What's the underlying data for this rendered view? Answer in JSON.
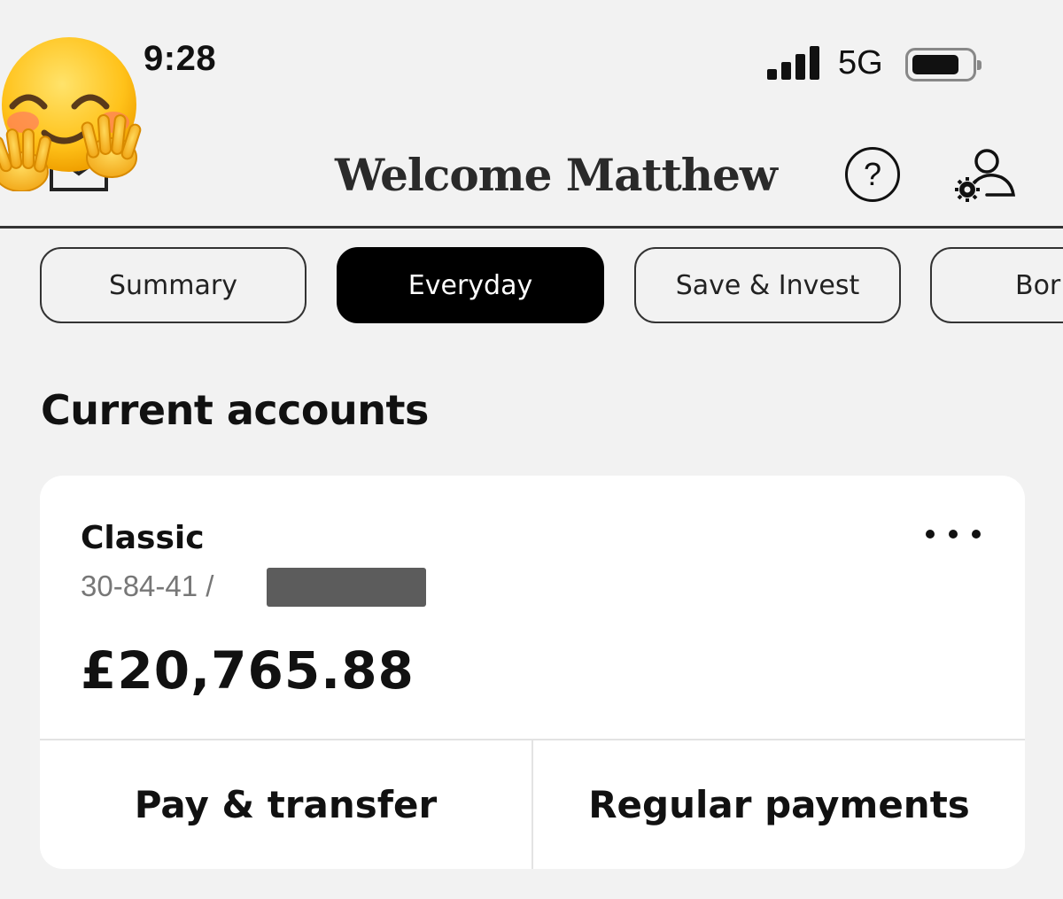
{
  "status_bar": {
    "time": "9:28",
    "network": "5G",
    "icons": [
      "signal-bars-icon",
      "battery-icon"
    ]
  },
  "header": {
    "title": "Welcome Matthew",
    "help_symbol": "?",
    "icons": [
      "mail-icon",
      "help-icon",
      "profile-settings-icon"
    ]
  },
  "sticker": "hugging-face-emoji",
  "tabs": [
    {
      "label": "Summary",
      "active": false
    },
    {
      "label": "Everyday",
      "active": true
    },
    {
      "label": "Save & Invest",
      "active": false
    },
    {
      "label": "Bor",
      "active": false
    }
  ],
  "section": {
    "title": "Current accounts"
  },
  "account": {
    "name": "Classic",
    "sort_code": "30-84-41 /",
    "balance": "£20,765.88",
    "more_icon": "more-options-icon",
    "actions": {
      "pay": "Pay & transfer",
      "regular": "Regular payments"
    }
  },
  "colors": {
    "background": "#f2f2f2",
    "active_tab": "#000000",
    "card": "#ffffff",
    "muted_text": "#777777"
  }
}
